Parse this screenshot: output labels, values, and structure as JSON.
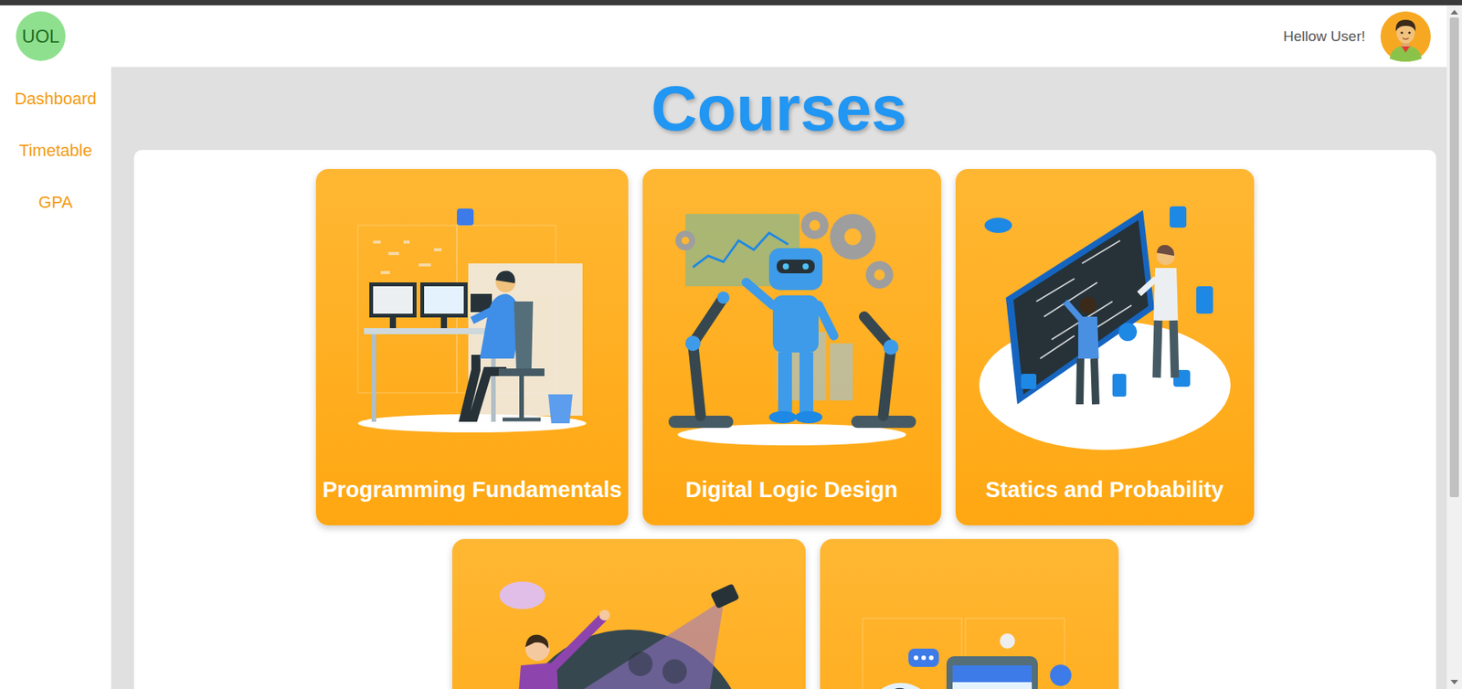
{
  "header": {
    "logo": "UOL",
    "greeting": "Hellow User!"
  },
  "sidebar": {
    "items": [
      {
        "label": "Dashboard"
      },
      {
        "label": "Timetable"
      },
      {
        "label": "GPA"
      }
    ]
  },
  "page": {
    "title": "Courses"
  },
  "courses": [
    {
      "title": "Programming Fundamentals",
      "kind": "coding"
    },
    {
      "title": "Digital Logic Design",
      "kind": "robot"
    },
    {
      "title": "Statics and Probability",
      "kind": "math"
    },
    {
      "title": "",
      "kind": "speaker"
    },
    {
      "title": "",
      "kind": "sales"
    }
  ]
}
